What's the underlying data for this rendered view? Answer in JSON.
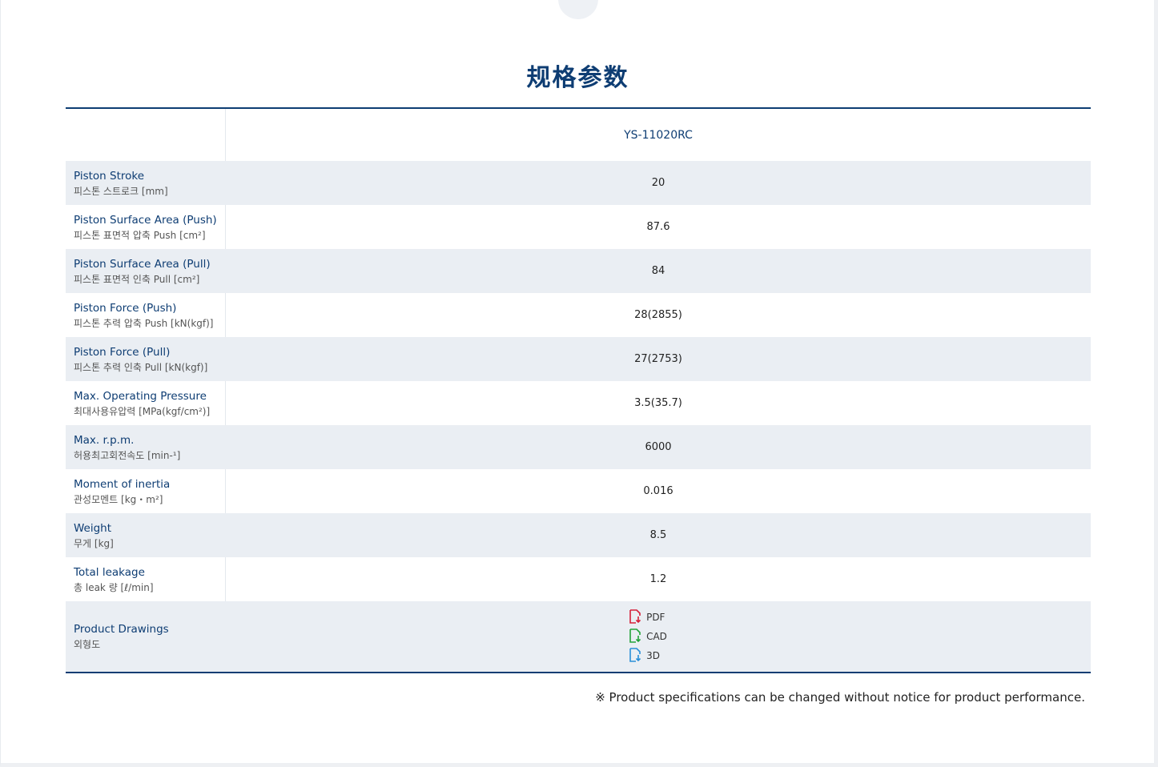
{
  "title": "规格参数",
  "model": "YS-11020RC",
  "rows": [
    {
      "en": "Piston Stroke",
      "ko": "피스톤 스트로크 [mm]",
      "value": "20"
    },
    {
      "en": "Piston Surface Area (Push)",
      "ko": "피스톤 표면적 압축 Push [cm²]",
      "value": "87.6"
    },
    {
      "en": "Piston Surface Area (Pull)",
      "ko": "피스톤 표면적 인축 Pull [cm²]",
      "value": "84"
    },
    {
      "en": "Piston Force (Push)",
      "ko": "피스톤 추력 압축 Push [kN(kgf)]",
      "value": "28(2855)"
    },
    {
      "en": "Piston Force (Pull)",
      "ko": "피스톤 추력 인축 Pull [kN(kgf)]",
      "value": "27(2753)"
    },
    {
      "en": "Max. Operating Pressure",
      "ko": "최대사용유압력 [MPa(kgf/cm²)]",
      "value": "3.5(35.7)"
    },
    {
      "en": "Max. r.p.m.",
      "ko": "허용최고회전속도 [min-¹]",
      "value": "6000"
    },
    {
      "en": "Moment of inertia",
      "ko": "관성모멘트 [kg・m²]",
      "value": "0.016"
    },
    {
      "en": "Weight",
      "ko": "무게 [kg]",
      "value": "8.5"
    },
    {
      "en": "Total leakage",
      "ko": "총 leak 량 [ℓ/min]",
      "value": "1.2"
    }
  ],
  "drawings": {
    "en": "Product Drawings",
    "ko": "외형도",
    "files": [
      {
        "label": "PDF",
        "icon": "pdf-file-icon",
        "color": "#d5203a"
      },
      {
        "label": "CAD",
        "icon": "cad-file-icon",
        "color": "#22a33a"
      },
      {
        "label": "3D",
        "icon": "3d-file-icon",
        "color": "#2a8fd8"
      }
    ]
  },
  "footnote": "※ Product specifications can be changed without notice for product performance."
}
